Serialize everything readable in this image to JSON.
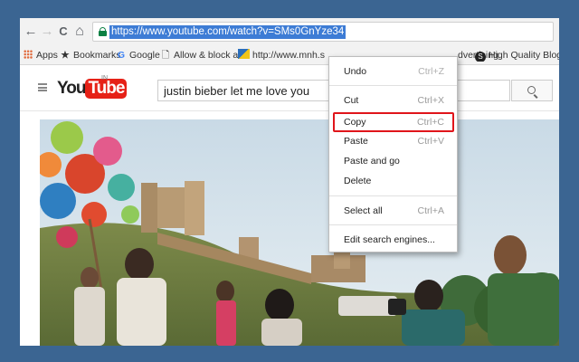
{
  "nav": {
    "back_icon": "←",
    "forward_icon": "→",
    "reload_icon": "C",
    "home_icon": "⌂"
  },
  "omnibox": {
    "url": "https://www.youtube.com/watch?v=SMs0GnYze34"
  },
  "bookmarks": [
    {
      "label": "Apps",
      "icon": "apps-icon"
    },
    {
      "label": "Bookmarks",
      "icon": "star-icon"
    },
    {
      "label": "Google",
      "icon": "google-icon"
    },
    {
      "label": "Allow & block ads",
      "icon": "page-icon"
    },
    {
      "label": "http://www.mnh.s",
      "icon": "pf-icon"
    },
    {
      "label": "dvertising",
      "icon": ""
    },
    {
      "label": "High Quality Blogge",
      "icon": "s-icon"
    }
  ],
  "youtube": {
    "logo_you": "You",
    "logo_tube": "Tube",
    "region": "IN",
    "search_value": "justin bieber let me love you"
  },
  "context_menu": {
    "items": [
      {
        "label": "Undo",
        "shortcut": "Ctrl+Z"
      },
      {
        "label": "Cut",
        "shortcut": "Ctrl+X"
      },
      {
        "label": "Copy",
        "shortcut": "Ctrl+C"
      },
      {
        "label": "Paste",
        "shortcut": "Ctrl+V"
      },
      {
        "label": "Paste and go",
        "shortcut": ""
      },
      {
        "label": "Delete",
        "shortcut": ""
      },
      {
        "label": "Select all",
        "shortcut": "Ctrl+A"
      },
      {
        "label": "Edit search engines...",
        "shortcut": ""
      }
    ],
    "highlighted": "Copy"
  },
  "colors": {
    "border": "#3b6592",
    "url_selection": "#3d7cd5",
    "highlight_box": "#e0151b",
    "youtube_red": "#e62117"
  }
}
